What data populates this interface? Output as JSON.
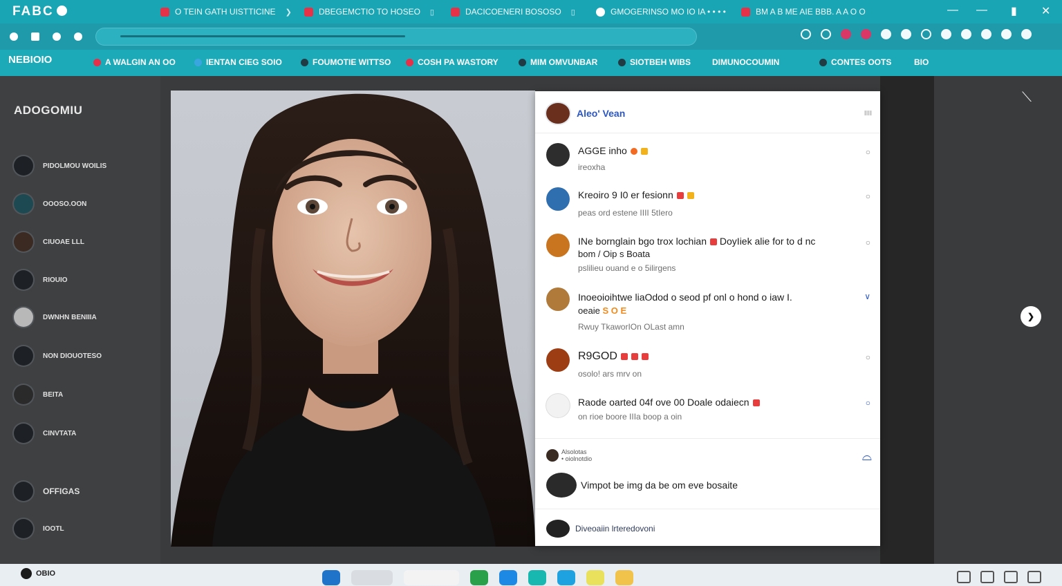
{
  "browser": {
    "brand": "FABC",
    "tabs": [
      {
        "label": "O TEIN GATH UISTTICINE",
        "close": "❯"
      },
      {
        "label": "DBEGEMCTIO TO HOSEO",
        "close": "▯"
      },
      {
        "label": "DACICOENERI BOSOSO",
        "close": "▯"
      },
      {
        "label": "GMOGERINSO MO IO IA • • • •",
        "close": ""
      },
      {
        "label": "BM A B ME AIE BBB. A A O O",
        "close": ""
      }
    ],
    "window_controls": [
      "—",
      "—",
      "▮",
      "✕"
    ]
  },
  "bookmarks": {
    "logo": "NEBIOIO",
    "items": [
      "A WALGIN AN OO",
      "IENTAN CIEG SOIO",
      "FOUMOTIE WITTSO",
      "COSH PA WASTORY",
      "MIM OMVUNBAR",
      "SIOTBEH WIBS",
      "DIMUNOCOUMIN",
      "CONTES OOTS",
      "BIO"
    ]
  },
  "sidebar": {
    "title": "ADOGOMIU",
    "items": [
      {
        "label": "PIDOLMOU WOILIS"
      },
      {
        "label": "OOOSO.OON"
      },
      {
        "label": "CIUOAE LLL"
      },
      {
        "label": "RIOUIO"
      },
      {
        "label": "DWNHN BENIIIA"
      },
      {
        "label": "NON DIOUOTESO"
      },
      {
        "label": "BEITA"
      },
      {
        "label": "CINVTATA"
      },
      {
        "label": "OFFIGAS"
      },
      {
        "label": "IOOTL"
      }
    ]
  },
  "panel": {
    "header_name": "Aleo' Vean",
    "header_more": "IIII",
    "messages": [
      {
        "title": "AGGE inho",
        "sub": "ireoxha"
      },
      {
        "title": "Kreoiro 9 I0 er fesionn",
        "sub": "peas ord estene  IIII 5tIero"
      },
      {
        "title": "INe bornglain bgo trox lochian",
        "title2": "DoyIiek alie for to d nc",
        "line2": "bom / Oip s Boata",
        "sub": "pslilieu ouand e o 5ilirgens"
      },
      {
        "title": "Inoeoioihtwe liaOdod o seod pf onl o hond o iaw I.",
        "line2": "oeaie",
        "badges": "S O E",
        "sub": "Rwuy  TkaworIOn  OLast amn"
      },
      {
        "title": "R9GOD",
        "sub": "osolo! ars mrv on"
      },
      {
        "title": "Raode oarted 04f ove 00 Doale odaiecn",
        "sub": "on rioe boore IIIa  boop a oin"
      }
    ],
    "comment_head": "Alsolotas",
    "comment_head_sub": "• oiolnotdio",
    "comment": "Vimpot be img da be om eve bosaite",
    "reply": "Diveoaiin lrteredovoni"
  },
  "taskbar": {
    "start_label": "OBIO"
  },
  "icons": {
    "close": "close-icon",
    "next": "chevron-right-icon"
  }
}
